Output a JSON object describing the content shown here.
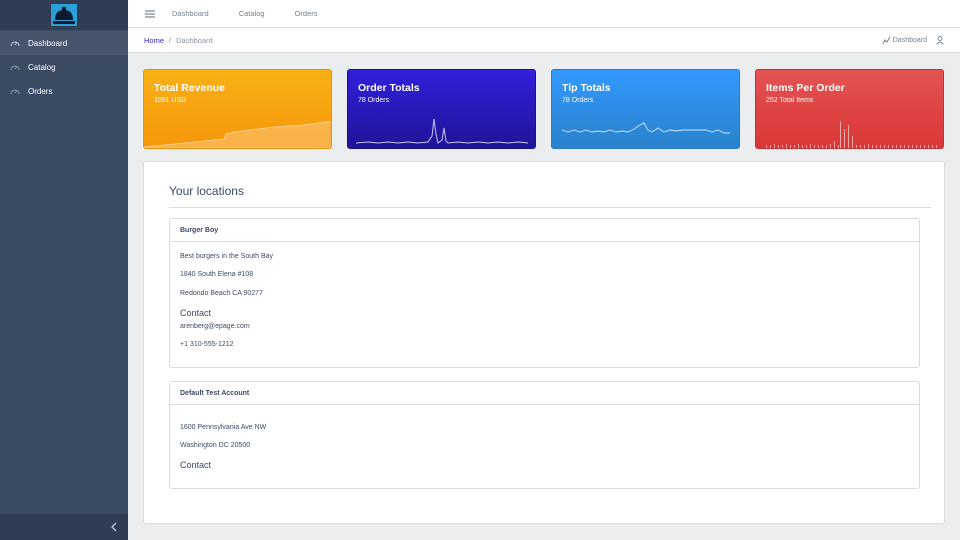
{
  "sidebar": {
    "items": [
      {
        "label": "Dashboard",
        "icon": "speedometer-icon"
      },
      {
        "label": "Catalog",
        "icon": "speedometer-icon"
      },
      {
        "label": "Orders",
        "icon": "speedometer-icon"
      }
    ],
    "minimizer_icon": "chevron-left-icon"
  },
  "header": {
    "links": [
      "Dashboard",
      "Catalog",
      "Orders"
    ]
  },
  "breadcrumb": {
    "home": "Home",
    "separator": "/",
    "current": "Dashboard",
    "right_link": "Dashboard"
  },
  "widgets": [
    {
      "title": "Total Revenue",
      "subtitle": "1091 USD",
      "color": "#f9b115"
    },
    {
      "title": "Order Totals",
      "subtitle": "78 Orders",
      "color": "#321fdb"
    },
    {
      "title": "Tip Totals",
      "subtitle": "78 Orders",
      "color": "#3399ff"
    },
    {
      "title": "Items Per Order",
      "subtitle": "252 Total Items",
      "color": "#e55353"
    }
  ],
  "locations": {
    "title": "Your locations",
    "cards": [
      {
        "name": "Burger Boy",
        "lines": [
          "Best burgers in the South Bay",
          "1840 South Elena #108",
          "Redondo Beach CA 90277"
        ],
        "contact_label": "Contact",
        "contact_lines": [
          "arenberg@epage.com",
          "+1 310-555-1212"
        ]
      },
      {
        "name": "Default Test Account",
        "lines": [
          "",
          "1600 Pennsylvania Ave NW",
          "Washington DC 20500"
        ],
        "contact_label": "Contact",
        "contact_lines": []
      }
    ]
  }
}
